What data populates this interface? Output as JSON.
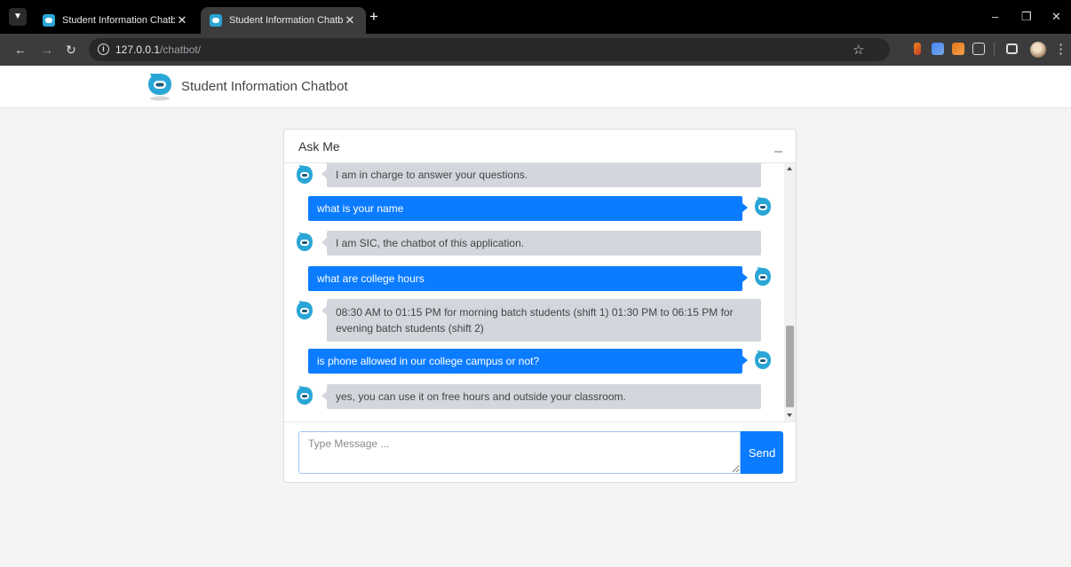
{
  "browser": {
    "tabs": [
      {
        "title": "Student Information Chatbot",
        "active": false
      },
      {
        "title": "Student Information Chatbot",
        "active": true
      }
    ],
    "url_host": "127.0.0.1",
    "url_path": "/chatbot/"
  },
  "navbar": {
    "brand": "Student Information Chatbot"
  },
  "chat": {
    "title": "Ask Me",
    "messages": [
      {
        "from": "bot",
        "text": "I am in charge to answer your questions."
      },
      {
        "from": "user",
        "text": "what is your name"
      },
      {
        "from": "bot",
        "text": "I am SIC, the chatbot of this application."
      },
      {
        "from": "user",
        "text": "what are college hours"
      },
      {
        "from": "bot",
        "text": "08:30 AM to 01:15 PM for morning batch students (shift 1) 01:30 PM to 06:15 PM for evening batch students (shift 2)"
      },
      {
        "from": "user",
        "text": "is phone allowed in our college campus or not?"
      },
      {
        "from": "bot",
        "text": "yes, you can use it on free hours and outside your classroom."
      }
    ],
    "input_placeholder": "Type Message ...",
    "send_label": "Send"
  },
  "colors": {
    "user_bubble": "#0b7cff",
    "bot_bubble": "#d3d6dc",
    "avatar": "#2aa6d6"
  }
}
